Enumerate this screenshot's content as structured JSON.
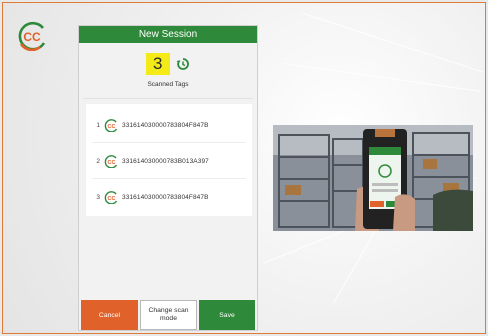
{
  "brand": {
    "logo_text": "CC"
  },
  "session": {
    "title": "New Session",
    "count": "3",
    "scanned_label": "Scanned Tags"
  },
  "tags": [
    {
      "index": "1",
      "id": "331614030000783804F847B"
    },
    {
      "index": "2",
      "id": "331614030000783B013A397"
    },
    {
      "index": "3",
      "id": "331614030000783804F847B"
    }
  ],
  "buttons": {
    "cancel": "Cancel",
    "change_mode": "Change scan mode",
    "save": "Save"
  },
  "icons": {
    "brand": "cc-logo-icon",
    "history": "history-icon",
    "tag": "cc-tag-icon"
  },
  "colors": {
    "header_green": "#2e8a3a",
    "save_green": "#2e8a3a",
    "cancel_orange": "#e0622a",
    "count_highlight": "#f4ea17",
    "frame_orange": "#e07a3a"
  }
}
